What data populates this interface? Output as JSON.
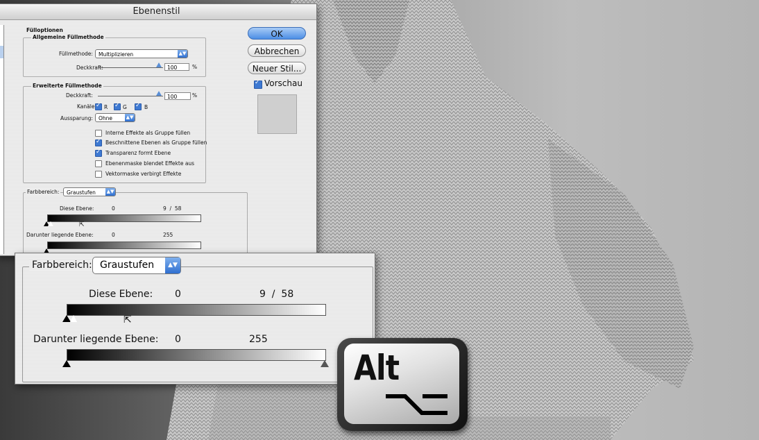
{
  "dialog": {
    "title": "Ebenenstil",
    "fill_options_heading": "Fülloptionen",
    "general_group": {
      "heading": "Allgemeine Füllmethode",
      "blend_mode_label": "Füllmethode:",
      "blend_mode_value": "Multiplizieren",
      "opacity_label": "Deckkraft:",
      "opacity_value": "100",
      "opacity_unit": "%",
      "opacity_level": 100
    },
    "advanced_group": {
      "heading": "Erweiterte Füllmethode",
      "opacity_label": "Deckkraft:",
      "opacity_value": "100",
      "opacity_unit": "%",
      "opacity_level": 100,
      "channels_label": "Kanäle:",
      "channels": [
        {
          "label": "R",
          "checked": true
        },
        {
          "label": "G",
          "checked": true
        },
        {
          "label": "B",
          "checked": true
        }
      ],
      "knockout_label": "Aussparung:",
      "knockout_value": "Ohne",
      "checkboxes": [
        {
          "label": "Interne Effekte als Gruppe füllen",
          "checked": false
        },
        {
          "label": "Beschnittene Ebenen als Gruppe füllen",
          "checked": true
        },
        {
          "label": "Transparenz formt Ebene",
          "checked": true
        },
        {
          "label": "Ebenenmaske blendet Effekte aus",
          "checked": false
        },
        {
          "label": "Vektormaske verbirgt Effekte",
          "checked": false
        }
      ]
    },
    "blend_if": {
      "label": "Farbbereich:",
      "value": "Graustufen",
      "this_layer_label": "Diese Ebene:",
      "this_layer_low": "0",
      "this_layer_high": "9  /  58",
      "underlying_label": "Darunter liegende Ebene:",
      "underlying_low": "0",
      "underlying_high": "255"
    },
    "buttons": {
      "ok": "OK",
      "cancel": "Abbrechen",
      "new_style": "Neuer Stil...",
      "preview_label": "Vorschau",
      "preview_checked": true
    }
  },
  "zoom": {
    "label": "Farbbereich:",
    "value": "Graustufen",
    "this_layer_label": "Diese Ebene:",
    "this_layer_low": "0",
    "this_layer_high": "9  /  58",
    "underlying_label": "Darunter liegende Ebene:",
    "underlying_low": "0",
    "underlying_high": "255"
  },
  "alt_key": {
    "label": "Alt",
    "symbol": "⌥"
  },
  "colors": {
    "accent": "#3e79d2",
    "dialog_bg": "#ececec"
  }
}
